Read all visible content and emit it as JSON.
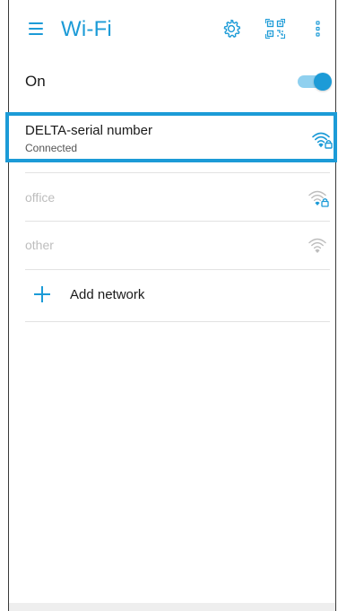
{
  "header": {
    "title": "Wi-Fi",
    "icons": [
      "menu-icon",
      "gear-icon",
      "qr-code-icon",
      "more-vertical-icon"
    ]
  },
  "wifi_toggle": {
    "label": "On",
    "state": "on"
  },
  "networks": [
    {
      "name": "DELTA-serial number",
      "status": "Connected",
      "secured": true,
      "signal": "full",
      "active": true,
      "color": "#1c9bd7"
    },
    {
      "name": "office",
      "status": "",
      "secured": true,
      "signal": "full",
      "active": false,
      "color": "#bdbdbd"
    },
    {
      "name": "other",
      "status": "",
      "secured": false,
      "signal": "full",
      "active": false,
      "color": "#bdbdbd"
    }
  ],
  "add_network": {
    "label": "Add network"
  },
  "colors": {
    "accent": "#1c9bd7",
    "accent_light": "#8fd0ef",
    "disabled_text": "#bdbdbd",
    "divider": "#e2e2e2"
  }
}
